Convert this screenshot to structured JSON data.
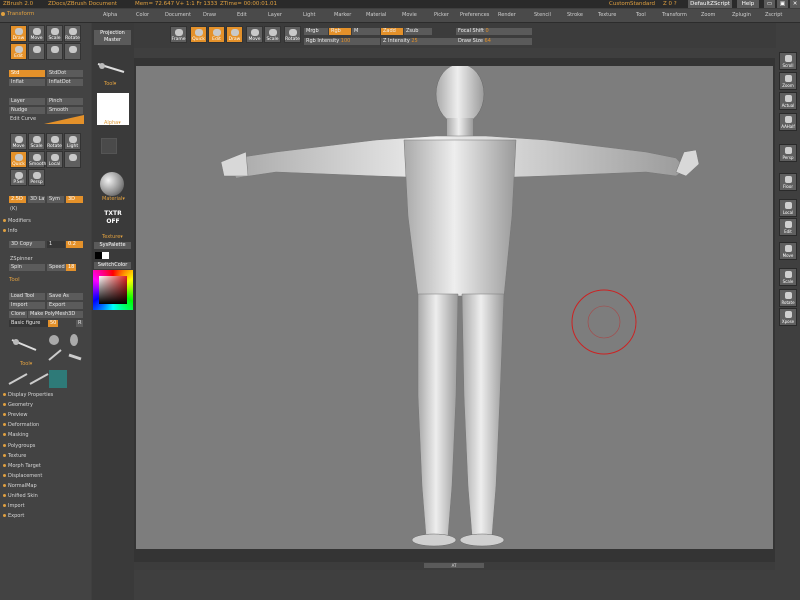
{
  "titlebar": {
    "app": "ZBrush 2.0",
    "doc": "ZDocs/ZBrush Document",
    "mem": "Mem= 72.647  V+ 1:1  Fr 1333",
    "time": "ZTime= 00:00:01.01",
    "custom": "Custom",
    "standard": "Standard",
    "z": "Z  0  ?",
    "script": "DefaultZScript",
    "help": "Help"
  },
  "menu": [
    "Alpha",
    "Color",
    "Document",
    "Draw",
    "Edit",
    "Layer",
    "Light",
    "Marker",
    "Material",
    "Movie",
    "Picker",
    "Preferences",
    "Render",
    "Stencil",
    "Stroke",
    "Texture",
    "Tool",
    "Transform",
    "Zoom",
    "Zplugin",
    "Zscript"
  ],
  "left": {
    "transform_label": "Transform",
    "icon_labels": [
      "Draw",
      "Move",
      "Scale",
      "Rotate",
      "Edit",
      "",
      "",
      ""
    ],
    "std": "Std",
    "stddot": "StdDot",
    "inflat": "Inflat",
    "inflatdot": "InflatDot",
    "layer": "Layer",
    "pinch": "Pinch",
    "nudge": "Nudge",
    "smooth": "Smooth",
    "edit_curve": "Edit Curve",
    "sym_icons": [
      "Move",
      "Scale",
      "Rotate",
      "Light",
      "Quick",
      "Smooth",
      "Local",
      "",
      "P.Sel",
      "Persp",
      "Local"
    ],
    "deform_btns": [
      "2.5D",
      "3D Layer",
      "Sym",
      "3D"
    ],
    "kx": "(K)",
    "modifiers": "Modifiers",
    "info": "Info",
    "d_copy": "3D Copy",
    "copy_val1": "1",
    "copy_val2": "0.2",
    "spinner": "ZSpinner",
    "spin": "Spin",
    "speed": "Speed",
    "speed_val": "18",
    "tool_label": "Tool",
    "load_tool": "Load Tool",
    "save_as": "Save As",
    "import": "Import",
    "export": "Export",
    "clone": "Clone",
    "make_poly": "Make PolyMesh3D",
    "basic_figure": "Basic figure",
    "basic_figure_val": "50",
    "r": "R",
    "tool_sub": "Tool▾",
    "subpalettes": [
      "Display Properties",
      "Geometry",
      "Preview",
      "Deformation",
      "Masking",
      "Polygroups",
      "Texture",
      "Morph Target",
      "Displacement",
      "NormalMap",
      "Unified Skin",
      "Import",
      "Export"
    ]
  },
  "col2": {
    "projection_master": "Projection Master",
    "tool_label": "Tool▾",
    "alpha_label": "Alpha▾",
    "material_label": "Material▾",
    "txtr": "TXTR",
    "off": "OFF",
    "texture_label": "Texture▾",
    "syspalette": "SysPalette",
    "switchcolor": "SwitchColor"
  },
  "toptools": {
    "icons": [
      "Frame",
      "Quick",
      "Edit",
      "Draw",
      "Move",
      "Scale",
      "Rotate"
    ],
    "mrgb": "Mrgb",
    "rgb": "Rgb",
    "m": "M",
    "zadd": "Zadd",
    "zsub": "Zsub",
    "rgb_intensity": "Rgb Intensity",
    "rgb_intensity_val": "100",
    "z_intensity": "Z Intensity",
    "z_intensity_val": "25",
    "focal_shift": "Focal Shift",
    "focal_shift_val": "0",
    "draw_size": "Draw Size",
    "draw_size_val": "64"
  },
  "right": [
    "Scroll",
    "Zoom",
    "Actual",
    "AAHalf",
    "Persp",
    "Floor",
    "Local",
    "Edit",
    "Move",
    "Scale",
    "Rotate",
    "Xpose",
    ""
  ],
  "bottom": "AT",
  "colors": {
    "accent": "#e4912a",
    "canvas": "#7d7d7d",
    "cursor": "#cc2222"
  }
}
